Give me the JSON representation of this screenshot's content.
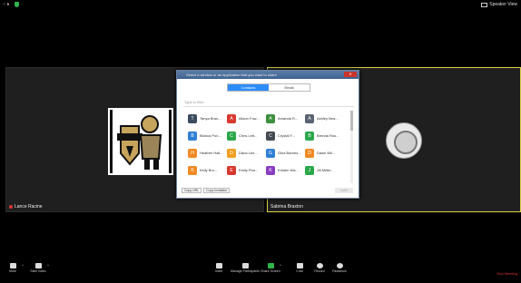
{
  "topbar": {
    "left_text": "○ ●",
    "right_label": "Speaker View",
    "shield_icon": "shield-icon"
  },
  "tiles": [
    {
      "name": "Lance Racine"
    },
    {
      "name": "Sabrina Braxton"
    }
  ],
  "dialog": {
    "title": "Select a window or an application that you want to share",
    "tabs": [
      {
        "label": "Contacts",
        "active": true
      },
      {
        "label": "Email",
        "active": false
      }
    ],
    "search_placeholder": "Type to filter",
    "contacts": [
      {
        "name": "Tanya Bran...",
        "color": "#3b4b5f",
        "initial": "T"
      },
      {
        "name": "Alison Fow...",
        "color": "#d8382f",
        "initial": "A"
      },
      {
        "name": "Amanda R...",
        "color": "#3e8f3e",
        "initial": "A"
      },
      {
        "name": "Ashley Bea...",
        "color": "#5a6474",
        "initial": "A"
      },
      {
        "name": "Bianca Pon...",
        "color": "#2f7fd6",
        "initial": "B"
      },
      {
        "name": "Chris Lett...",
        "color": "#2aa84a",
        "initial": "C"
      },
      {
        "name": "Crystal F...",
        "color": "#444a52",
        "initial": "C"
      },
      {
        "name": "Brenda Rus...",
        "color": "#2aa84a",
        "initial": "B"
      },
      {
        "name": "Heather Hall...",
        "color": "#f08a24",
        "initial": "H"
      },
      {
        "name": "Dana Lee...",
        "color": "#f0a020",
        "initial": "D"
      },
      {
        "name": "Gina Barnes...",
        "color": "#2f7fd6",
        "initial": "G"
      },
      {
        "name": "Dawn Wil...",
        "color": "#f08a24",
        "initial": "D"
      },
      {
        "name": "Kelly Bro...",
        "color": "#f08a24",
        "initial": "K"
      },
      {
        "name": "Emily Pau...",
        "color": "#d8382f",
        "initial": "E"
      },
      {
        "name": "Kristen Wa...",
        "color": "#8a3cc2",
        "initial": "K"
      },
      {
        "name": "Jill Miller...",
        "color": "#2aa84a",
        "initial": "J"
      }
    ],
    "footer_buttons": [
      "Copy URL",
      "Copy Invitation"
    ],
    "invite_button": "Invite"
  },
  "toolbar": {
    "items": [
      {
        "label": "Mute",
        "icon": "microphone-icon"
      },
      {
        "label": "Start Video",
        "icon": "video-off-icon"
      },
      {
        "label": "Invite",
        "icon": "add-user-icon"
      },
      {
        "label": "Manage Participants",
        "icon": "participants-icon",
        "count": "3"
      },
      {
        "label": "Share Screen",
        "icon": "share-screen-icon"
      },
      {
        "label": "Chat",
        "icon": "chat-icon"
      },
      {
        "label": "Record",
        "icon": "record-icon"
      },
      {
        "label": "Reactions",
        "icon": "reactions-icon"
      }
    ],
    "end_label": "End Meeting"
  }
}
